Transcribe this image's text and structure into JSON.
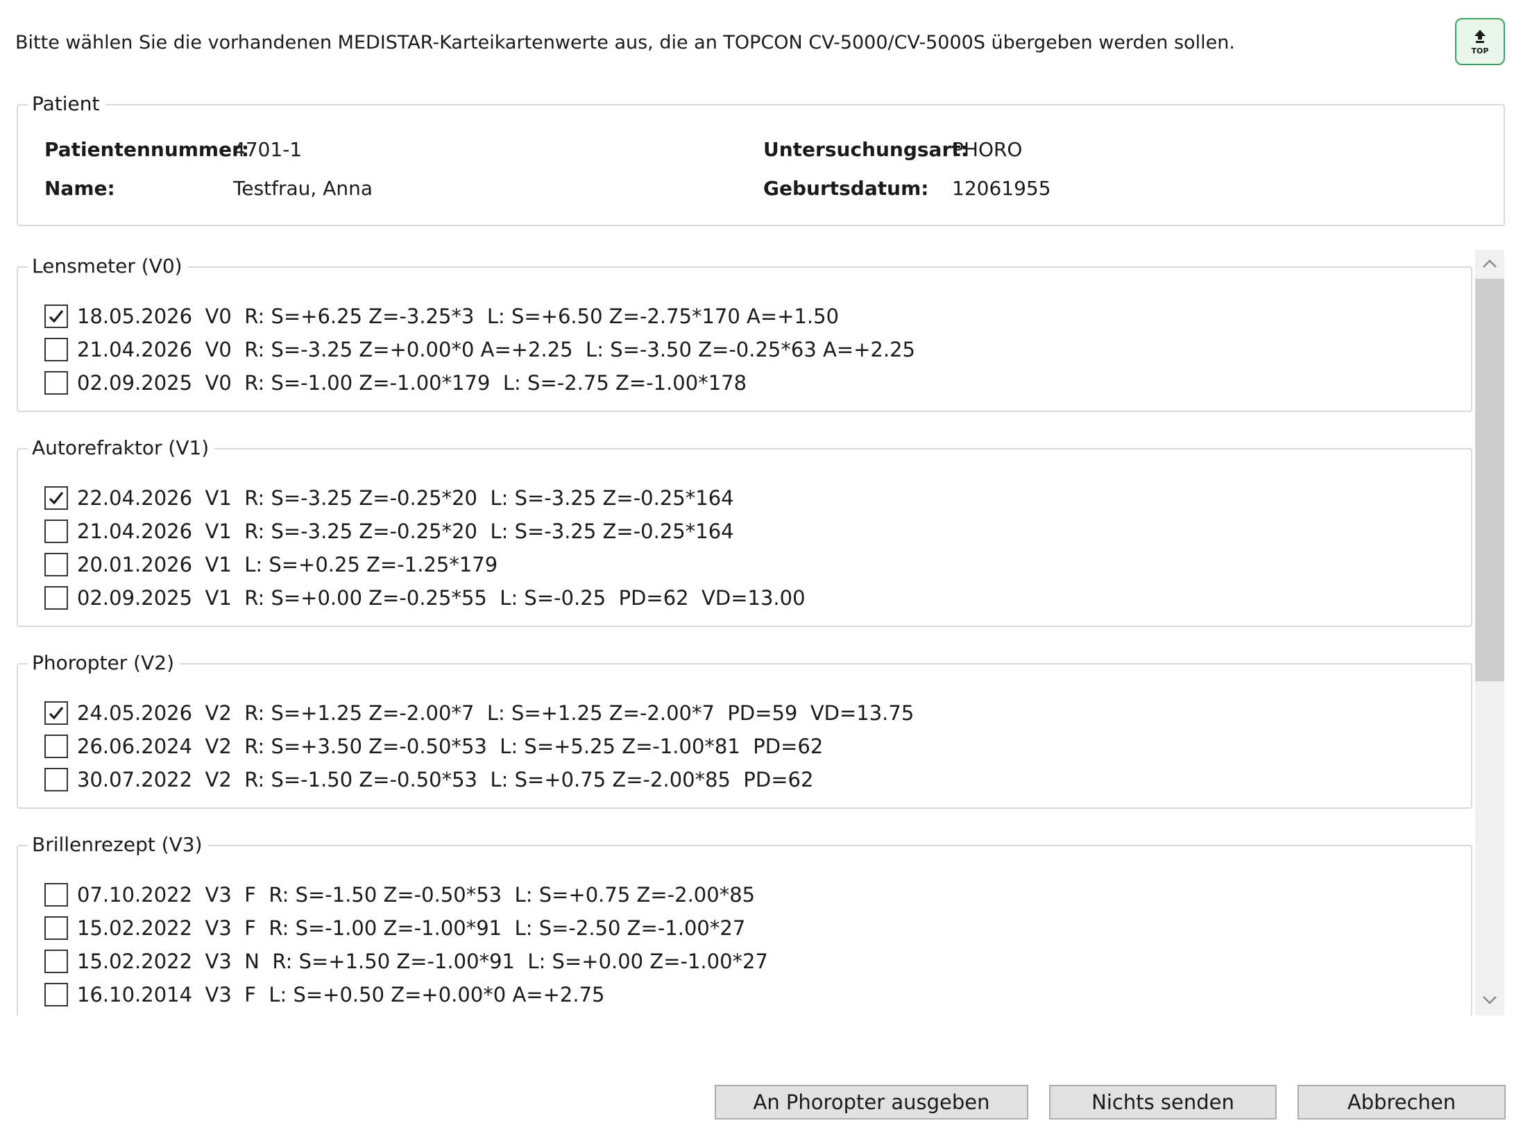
{
  "instruction": "Bitte wählen Sie die vorhandenen MEDISTAR-Karteikartenwerte aus, die an TOPCON CV-5000/CV-5000S übergeben werden sollen.",
  "top_button": {
    "label": "TOP",
    "icon": "arrow-up-icon"
  },
  "patient": {
    "title": "Patient",
    "number_label": "Patientennummer:",
    "number_value": "4701-1",
    "name_label": "Name:",
    "name_value": "Testfrau, Anna",
    "exam_label": "Untersuchungsart:",
    "exam_value": "PHORO",
    "birth_label": "Geburtsdatum:",
    "birth_value": "12061955"
  },
  "groups": [
    {
      "title": "Lensmeter (V0)",
      "rows": [
        {
          "checked": true,
          "text": "18.05.2026  V0  R: S=+6.25 Z=-3.25*3  L: S=+6.50 Z=-2.75*170 A=+1.50"
        },
        {
          "checked": false,
          "text": "21.04.2026  V0  R: S=-3.25 Z=+0.00*0 A=+2.25  L: S=-3.50 Z=-0.25*63 A=+2.25"
        },
        {
          "checked": false,
          "text": "02.09.2025  V0  R: S=-1.00 Z=-1.00*179  L: S=-2.75 Z=-1.00*178"
        }
      ]
    },
    {
      "title": "Autorefraktor (V1)",
      "rows": [
        {
          "checked": true,
          "text": "22.04.2026  V1  R: S=-3.25 Z=-0.25*20  L: S=-3.25 Z=-0.25*164"
        },
        {
          "checked": false,
          "text": "21.04.2026  V1  R: S=-3.25 Z=-0.25*20  L: S=-3.25 Z=-0.25*164"
        },
        {
          "checked": false,
          "text": "20.01.2026  V1  L: S=+0.25 Z=-1.25*179"
        },
        {
          "checked": false,
          "text": "02.09.2025  V1  R: S=+0.00 Z=-0.25*55  L: S=-0.25  PD=62  VD=13.00"
        }
      ]
    },
    {
      "title": "Phoropter (V2)",
      "rows": [
        {
          "checked": true,
          "text": "24.05.2026  V2  R: S=+1.25 Z=-2.00*7  L: S=+1.25 Z=-2.00*7  PD=59  VD=13.75"
        },
        {
          "checked": false,
          "text": "26.06.2024  V2  R: S=+3.50 Z=-0.50*53  L: S=+5.25 Z=-1.00*81  PD=62"
        },
        {
          "checked": false,
          "text": "30.07.2022  V2  R: S=-1.50 Z=-0.50*53  L: S=+0.75 Z=-2.00*85  PD=62"
        }
      ]
    },
    {
      "title": "Brillenrezept (V3)",
      "rows": [
        {
          "checked": false,
          "text": "07.10.2022  V3  F  R: S=-1.50 Z=-0.50*53  L: S=+0.75 Z=-2.00*85"
        },
        {
          "checked": false,
          "text": "15.02.2022  V3  F  R: S=-1.00 Z=-1.00*91  L: S=-2.50 Z=-1.00*27"
        },
        {
          "checked": false,
          "text": "15.02.2022  V3  N  R: S=+1.50 Z=-1.00*91  L: S=+0.00 Z=-1.00*27"
        },
        {
          "checked": false,
          "text": "16.10.2014  V3  F  L: S=+0.50 Z=+0.00*0 A=+2.75"
        }
      ]
    }
  ],
  "buttons": {
    "send": "An Phoropter ausgeben",
    "none": "Nichts senden",
    "cancel": "Abbrechen"
  },
  "colors": {
    "top_button_border": "#3ba35a",
    "top_button_fill": "#e9f6ec",
    "group_border": "#d9d9d9",
    "button_fill": "#e1e1e1",
    "button_border": "#adadad",
    "scrollbar_track": "#f0f0f0",
    "scrollbar_thumb": "#cdcdcd"
  }
}
